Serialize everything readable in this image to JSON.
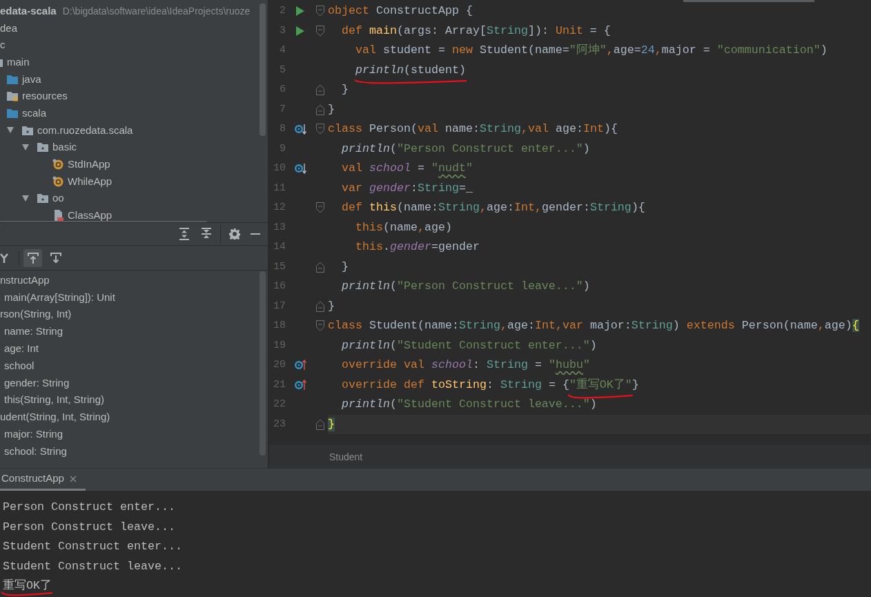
{
  "project_tree": {
    "items": [
      {
        "label": "edata-scala",
        "path": "D:\\bigdata\\software\\idea\\IdeaProjects\\ruoze",
        "children": [
          {
            "label": "dea"
          },
          {
            "label": "c",
            "children": [
              {
                "label": "main",
                "kind": "folder",
                "children": [
                  {
                    "label": "java",
                    "kind": "source-folder"
                  },
                  {
                    "label": "resources",
                    "kind": "resources-folder"
                  },
                  {
                    "label": "scala",
                    "kind": "source-folder",
                    "children": [
                      {
                        "label": "com.ruozedata.scala",
                        "kind": "package",
                        "expanded": true,
                        "children": [
                          {
                            "label": "basic",
                            "kind": "package",
                            "expanded": true,
                            "children": [
                              {
                                "label": "StdInApp",
                                "kind": "object"
                              },
                              {
                                "label": "WhileApp",
                                "kind": "object"
                              }
                            ]
                          },
                          {
                            "label": "oo",
                            "kind": "package",
                            "expanded": true,
                            "children": [
                              {
                                "label": "ClassApp",
                                "kind": "class-file"
                              }
                            ]
                          }
                        ]
                      }
                    ]
                  }
                ]
              }
            ]
          }
        ]
      }
    ]
  },
  "structure": {
    "toolbar": [
      {
        "selected": true
      },
      {
        "selected": false
      }
    ],
    "items": [
      {
        "label": "nstructApp",
        "children": [
          {
            "label": "main(Array[String]): Unit"
          }
        ]
      },
      {
        "label": "rson(String, Int)",
        "children": [
          {
            "label": "name: String"
          },
          {
            "label": "age: Int"
          },
          {
            "label": "school"
          },
          {
            "label": "gender: String"
          },
          {
            "label": "this(String, Int, String)"
          }
        ]
      },
      {
        "label": "udent(String, Int, String)",
        "children": [
          {
            "label": "major: String"
          },
          {
            "label": "school: String"
          }
        ]
      }
    ]
  },
  "editor": {
    "lines": [
      {
        "number": "2",
        "gutter": {
          "kind": "run"
        },
        "fold": {
          "kind": "start"
        },
        "current": false,
        "tokens": [
          {
            "text": "object",
            "kind": "keyword"
          },
          {
            "text": " ConstructApp {",
            "kind": "plain"
          }
        ]
      },
      {
        "number": "3",
        "gutter": {
          "kind": "run"
        },
        "fold": {
          "kind": "start"
        },
        "current": false,
        "tokens": [
          {
            "text": "  def ",
            "kind": "keyword"
          },
          {
            "text": "main",
            "kind": "method"
          },
          {
            "text": "(args: Array[",
            "kind": "plain"
          },
          {
            "text": "String",
            "kind": "type"
          },
          {
            "text": "]): ",
            "kind": "plain"
          },
          {
            "text": "Unit",
            "kind": "keyword"
          },
          {
            "text": " = {",
            "kind": "plain"
          }
        ]
      },
      {
        "number": "4",
        "current": false,
        "tokens": [
          {
            "text": "    val",
            "kind": "keyword"
          },
          {
            "text": " student = ",
            "kind": "plain"
          },
          {
            "text": "new",
            "kind": "keyword"
          },
          {
            "text": " Student(name=",
            "kind": "plain"
          },
          {
            "text": "\"阿坤\"",
            "kind": "string"
          },
          {
            "text": ",",
            "kind": "separator"
          },
          {
            "text": "age=",
            "kind": "plain"
          },
          {
            "text": "24",
            "kind": "number"
          },
          {
            "text": ",",
            "kind": "separator"
          },
          {
            "text": "major = ",
            "kind": "plain"
          },
          {
            "text": "\"communication\"",
            "kind": "string"
          },
          {
            "text": ")",
            "kind": "plain"
          }
        ]
      },
      {
        "number": "5",
        "current": false,
        "tokens": [
          {
            "text": "    println",
            "kind": "call",
            "annotated": true
          },
          {
            "text": "(student)",
            "kind": "plain",
            "annotated": true
          }
        ]
      },
      {
        "number": "6",
        "fold": {
          "kind": "end"
        },
        "current": false,
        "tokens": [
          {
            "text": "  }",
            "kind": "plain"
          }
        ]
      },
      {
        "number": "7",
        "fold": {
          "kind": "end"
        },
        "current": false,
        "tokens": [
          {
            "text": "}",
            "kind": "plain"
          }
        ]
      },
      {
        "number": "8",
        "gutter": {
          "kind": "overridden"
        },
        "fold": {
          "kind": "start"
        },
        "current": false,
        "tokens": [
          {
            "text": "class",
            "kind": "keyword"
          },
          {
            "text": " Person(",
            "kind": "plain"
          },
          {
            "text": "val",
            "kind": "keyword"
          },
          {
            "text": " name:",
            "kind": "plain"
          },
          {
            "text": "String",
            "kind": "type"
          },
          {
            "text": ",",
            "kind": "separator"
          },
          {
            "text": "val",
            "kind": "keyword"
          },
          {
            "text": " age:",
            "kind": "plain"
          },
          {
            "text": "Int",
            "kind": "keyword"
          },
          {
            "text": "){",
            "kind": "plain"
          }
        ]
      },
      {
        "number": "9",
        "current": false,
        "tokens": [
          {
            "text": "  println",
            "kind": "call"
          },
          {
            "text": "(",
            "kind": "plain"
          },
          {
            "text": "\"Person Construct enter...\"",
            "kind": "string"
          },
          {
            "text": ")",
            "kind": "plain"
          }
        ]
      },
      {
        "number": "10",
        "gutter": {
          "kind": "overridden"
        },
        "current": false,
        "tokens": [
          {
            "text": "  val ",
            "kind": "keyword"
          },
          {
            "text": "school",
            "kind": "field"
          },
          {
            "text": " = ",
            "kind": "plain"
          },
          {
            "text": "\"",
            "kind": "string"
          },
          {
            "text": "nudt",
            "kind": "string-typo"
          },
          {
            "text": "\"",
            "kind": "string"
          }
        ]
      },
      {
        "number": "11",
        "current": false,
        "tokens": [
          {
            "text": "  var ",
            "kind": "keyword"
          },
          {
            "text": "gender",
            "kind": "field"
          },
          {
            "text": ":",
            "kind": "plain"
          },
          {
            "text": "String",
            "kind": "type"
          },
          {
            "text": "=_",
            "kind": "plain"
          }
        ]
      },
      {
        "number": "12",
        "fold": {
          "kind": "start"
        },
        "current": false,
        "tokens": [
          {
            "text": "  def ",
            "kind": "keyword"
          },
          {
            "text": "this",
            "kind": "method"
          },
          {
            "text": "(name:",
            "kind": "plain"
          },
          {
            "text": "String",
            "kind": "type"
          },
          {
            "text": ",",
            "kind": "separator"
          },
          {
            "text": "age:",
            "kind": "plain"
          },
          {
            "text": "Int",
            "kind": "keyword"
          },
          {
            "text": ",",
            "kind": "separator"
          },
          {
            "text": "gender:",
            "kind": "plain"
          },
          {
            "text": "String",
            "kind": "type"
          },
          {
            "text": "){",
            "kind": "plain"
          }
        ]
      },
      {
        "number": "13",
        "current": false,
        "tokens": [
          {
            "text": "    this",
            "kind": "keyword"
          },
          {
            "text": "(name",
            "kind": "plain"
          },
          {
            "text": ",",
            "kind": "separator"
          },
          {
            "text": "age)",
            "kind": "plain"
          }
        ]
      },
      {
        "number": "14",
        "current": false,
        "tokens": [
          {
            "text": "    this",
            "kind": "keyword"
          },
          {
            "text": ".",
            "kind": "plain"
          },
          {
            "text": "gender",
            "kind": "field"
          },
          {
            "text": "=gender",
            "kind": "plain"
          }
        ]
      },
      {
        "number": "15",
        "fold": {
          "kind": "end"
        },
        "current": false,
        "tokens": [
          {
            "text": "  }",
            "kind": "plain"
          }
        ]
      },
      {
        "number": "16",
        "current": false,
        "tokens": [
          {
            "text": "  println",
            "kind": "call"
          },
          {
            "text": "(",
            "kind": "plain"
          },
          {
            "text": "\"Person Construct leave...\"",
            "kind": "string"
          },
          {
            "text": ")",
            "kind": "plain"
          }
        ]
      },
      {
        "number": "17",
        "fold": {
          "kind": "end"
        },
        "current": false,
        "tokens": [
          {
            "text": "}",
            "kind": "plain"
          }
        ]
      },
      {
        "number": "18",
        "fold": {
          "kind": "start"
        },
        "current": false,
        "tokens": [
          {
            "text": "class",
            "kind": "keyword"
          },
          {
            "text": " Student(name:",
            "kind": "plain"
          },
          {
            "text": "String",
            "kind": "type"
          },
          {
            "text": ",",
            "kind": "separator"
          },
          {
            "text": "age:",
            "kind": "plain"
          },
          {
            "text": "Int",
            "kind": "keyword"
          },
          {
            "text": ",",
            "kind": "separator"
          },
          {
            "text": "var",
            "kind": "keyword"
          },
          {
            "text": " major:",
            "kind": "plain"
          },
          {
            "text": "String",
            "kind": "type"
          },
          {
            "text": ") ",
            "kind": "plain"
          },
          {
            "text": "extends",
            "kind": "keyword"
          },
          {
            "text": " Person(name",
            "kind": "plain"
          },
          {
            "text": ",",
            "kind": "separator"
          },
          {
            "text": "age)",
            "kind": "plain"
          },
          {
            "text": "{",
            "kind": "brace-match"
          }
        ]
      },
      {
        "number": "19",
        "current": false,
        "tokens": [
          {
            "text": "  println",
            "kind": "call"
          },
          {
            "text": "(",
            "kind": "plain"
          },
          {
            "text": "\"Student Construct enter...\"",
            "kind": "string"
          },
          {
            "text": ")",
            "kind": "plain"
          }
        ]
      },
      {
        "number": "20",
        "gutter": {
          "kind": "overrides"
        },
        "current": false,
        "tokens": [
          {
            "text": "  override val ",
            "kind": "keyword"
          },
          {
            "text": "school",
            "kind": "field"
          },
          {
            "text": ": ",
            "kind": "plain"
          },
          {
            "text": "String",
            "kind": "type"
          },
          {
            "text": " = ",
            "kind": "plain"
          },
          {
            "text": "\"",
            "kind": "string"
          },
          {
            "text": "hubu",
            "kind": "string-typo"
          },
          {
            "text": "\"",
            "kind": "string"
          }
        ]
      },
      {
        "number": "21",
        "gutter": {
          "kind": "overrides"
        },
        "current": false,
        "tokens": [
          {
            "text": "  override def ",
            "kind": "keyword"
          },
          {
            "text": "toString",
            "kind": "method"
          },
          {
            "text": ": ",
            "kind": "plain"
          },
          {
            "text": "String",
            "kind": "type"
          },
          {
            "text": " = {",
            "kind": "plain"
          },
          {
            "text": "\"重写OK了\"",
            "kind": "string",
            "annotated": true
          },
          {
            "text": "}",
            "kind": "plain"
          }
        ]
      },
      {
        "number": "22",
        "current": false,
        "tokens": [
          {
            "text": "  println",
            "kind": "call"
          },
          {
            "text": "(",
            "kind": "plain"
          },
          {
            "text": "\"Student Construct leave...\"",
            "kind": "string"
          },
          {
            "text": ")",
            "kind": "plain"
          }
        ]
      },
      {
        "number": "23",
        "fold": {
          "kind": "end"
        },
        "current": true,
        "tokens": [
          {
            "text": "}",
            "kind": "brace-match"
          }
        ]
      }
    ]
  },
  "breadcrumb": [
    "Student"
  ],
  "run_panel": {
    "tabs": [
      {
        "label": "ConstructApp",
        "selected": true
      }
    ],
    "output": [
      {
        "text": "Person Construct enter...",
        "annotated": false
      },
      {
        "text": "Person Construct leave...",
        "annotated": false
      },
      {
        "text": "Student Construct enter...",
        "annotated": false
      },
      {
        "text": "Student Construct leave...",
        "annotated": false
      },
      {
        "text": "重写OK了",
        "annotated": true
      }
    ]
  }
}
